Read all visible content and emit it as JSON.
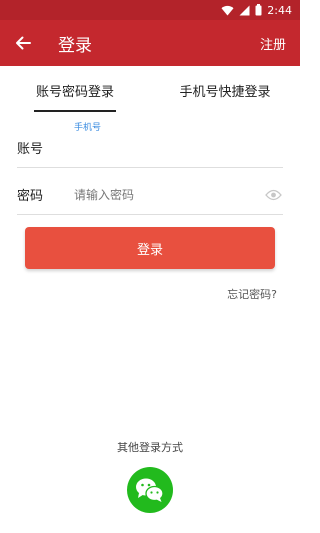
{
  "status_bar": {
    "time": "2:44"
  },
  "app_bar": {
    "title": "登录",
    "register_label": "注册"
  },
  "tabs": [
    {
      "label": "账号密码登录",
      "active": true
    },
    {
      "label": "手机号快捷登录",
      "active": false
    }
  ],
  "account_field": {
    "hint": "手机号",
    "label": "账号",
    "value": ""
  },
  "password_field": {
    "label": "密码",
    "placeholder": "请输入密码"
  },
  "login_button": {
    "label": "登录"
  },
  "forgot_link": {
    "label": "忘记密码?"
  },
  "other_login": {
    "label": "其他登录方式",
    "method_icon": "wechat-icon"
  },
  "colors": {
    "status_bar": "#b3232a",
    "app_bar": "#c4282e",
    "login_button": "#e8503f",
    "wechat": "#22ba1d",
    "hint": "#3a8be0"
  }
}
